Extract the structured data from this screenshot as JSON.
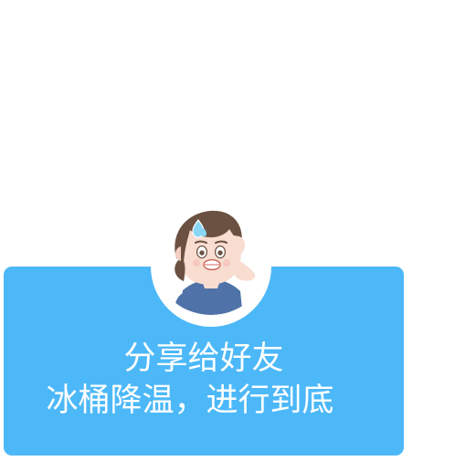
{
  "share_card": {
    "line_1": "分享给好友",
    "line_2": "冰桶降温，进行到底"
  },
  "colors": {
    "card_blue": "#4db8f8",
    "shirt_blue": "#4f73a8",
    "hair_brown": "#6b5142",
    "skin": "#f8ddd0",
    "sweat_drop": "#89d6f5",
    "white": "#ffffff"
  },
  "icons": {
    "avatar": "worried-boy-avatar-icon",
    "sweat": "sweat-drop-icon"
  }
}
